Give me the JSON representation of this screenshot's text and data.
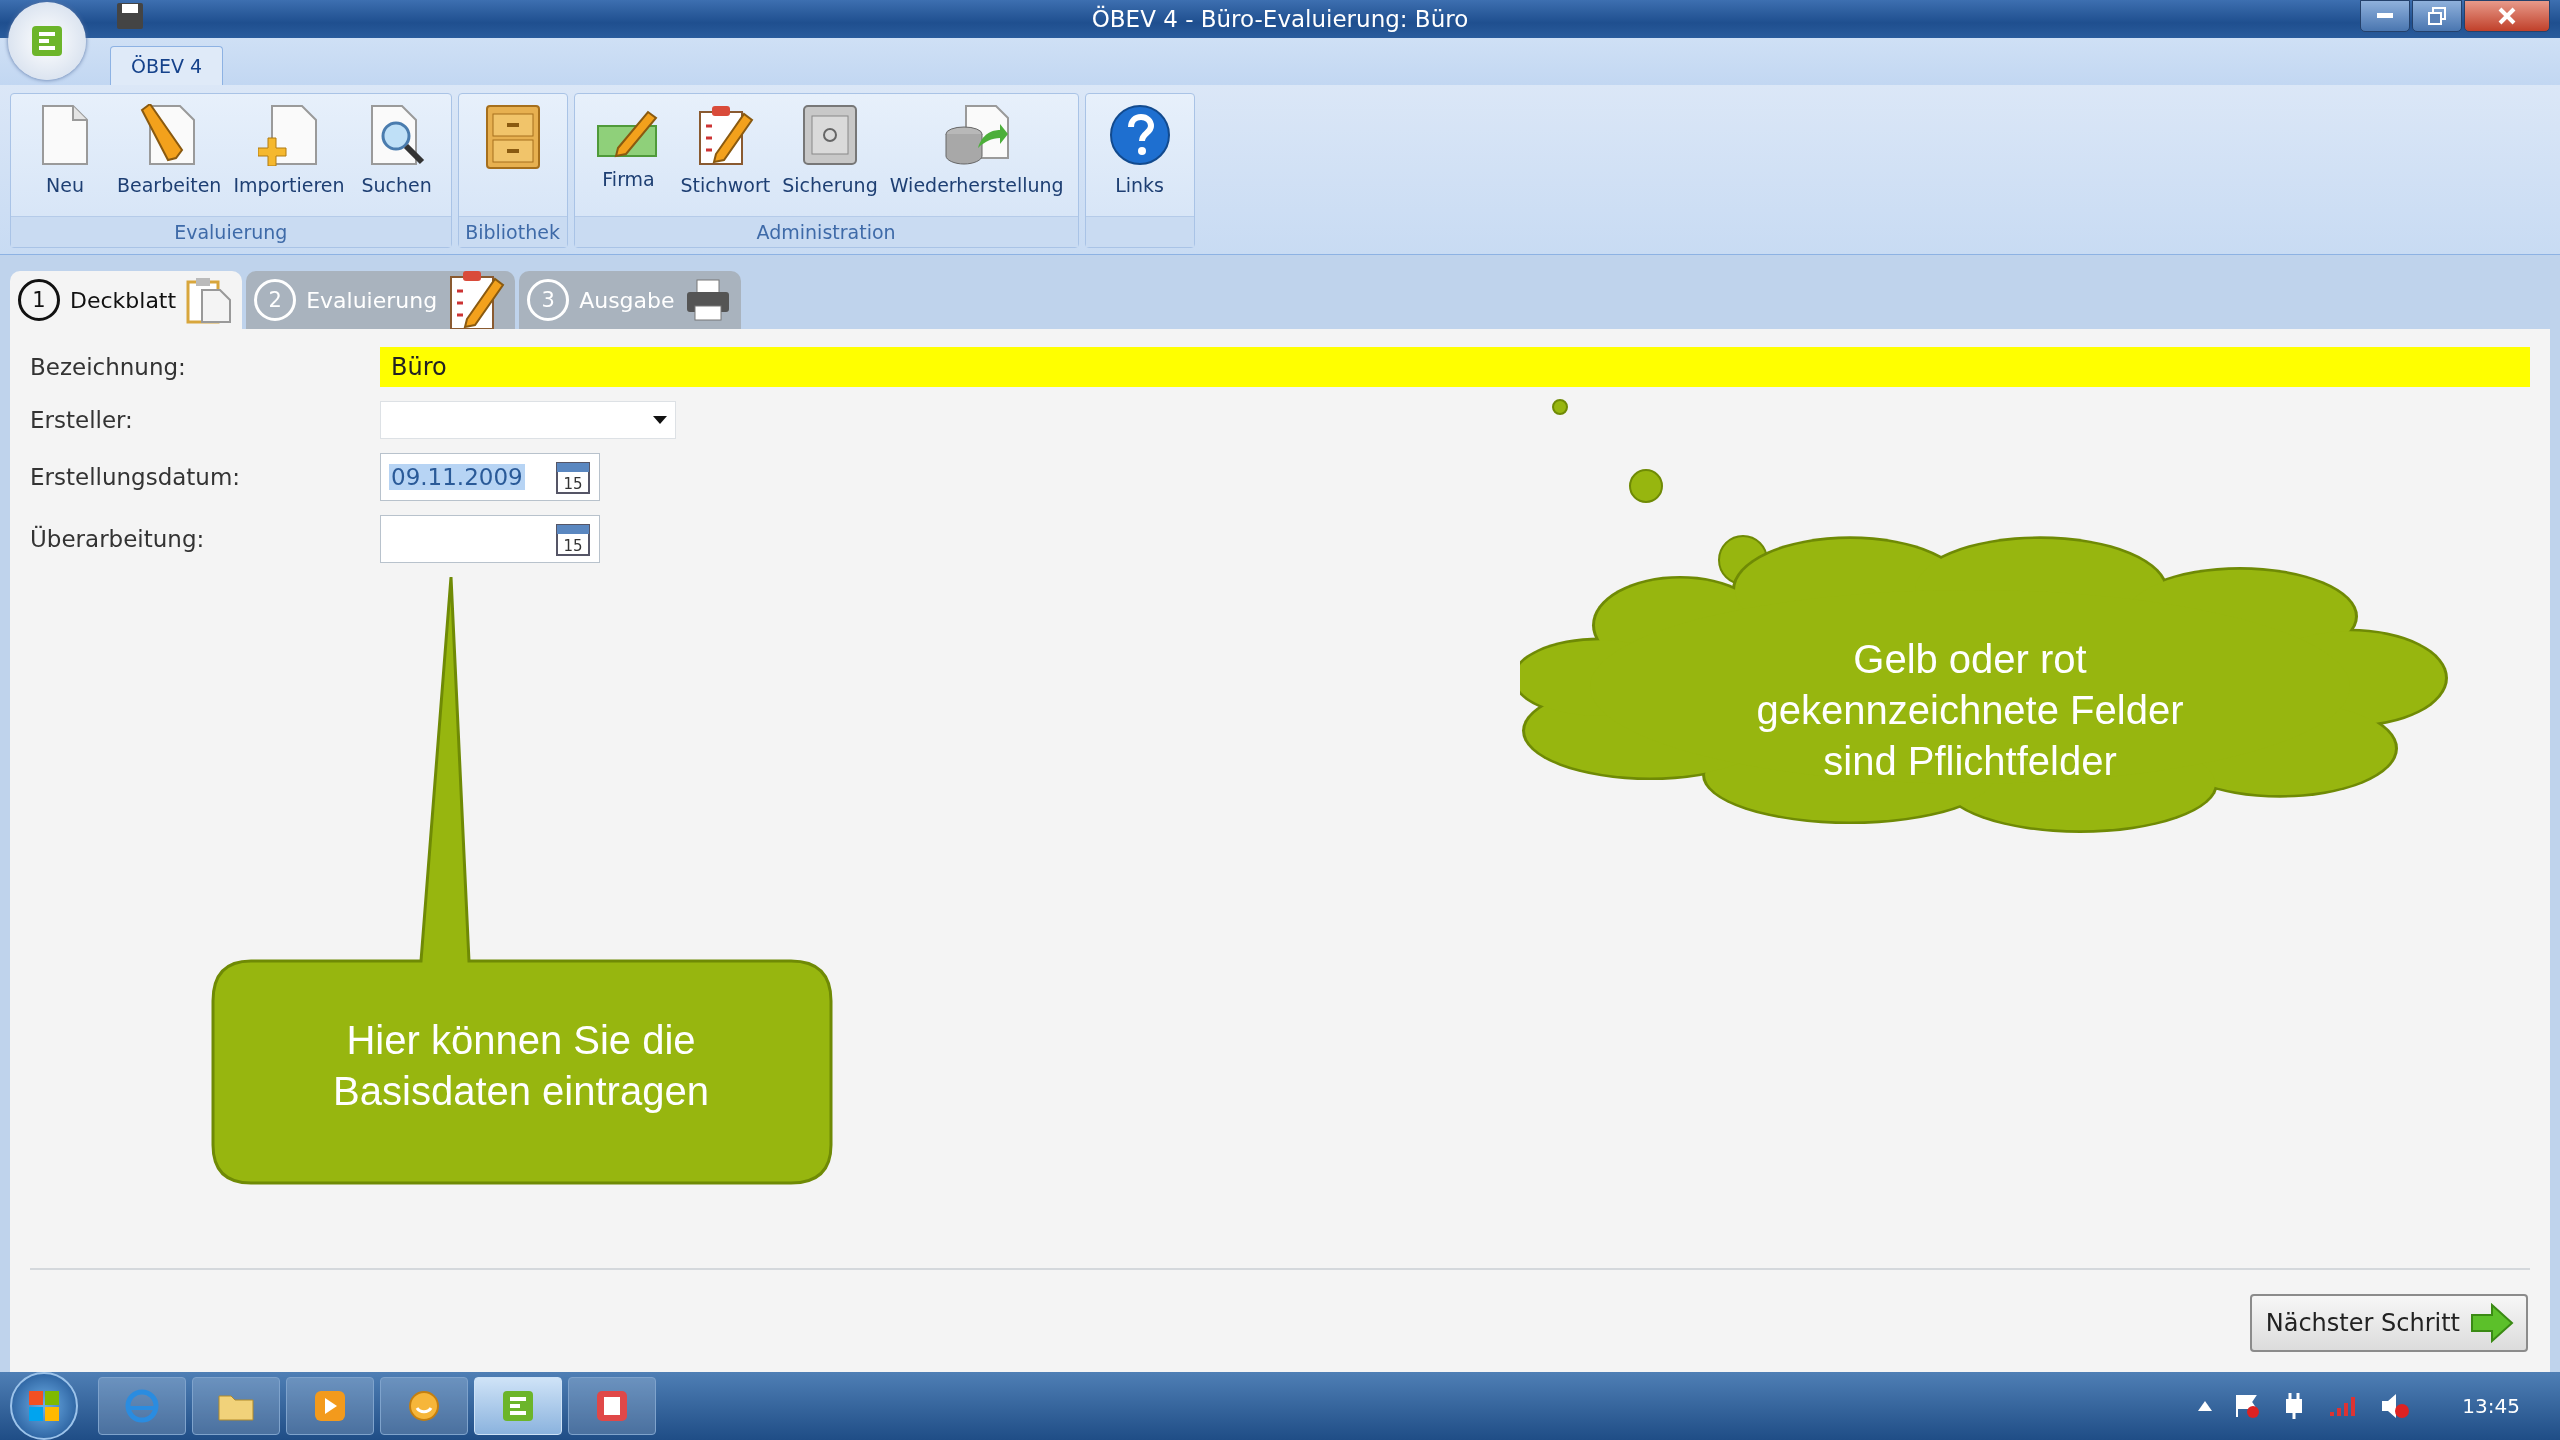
{
  "window": {
    "title": "ÖBEV 4 - Büro-Evaluierung: Büro"
  },
  "ribbon": {
    "tabs": [
      {
        "label": "ÖBEV 4",
        "selected": true
      }
    ],
    "groups": [
      {
        "label": "Evaluierung",
        "buttons": [
          {
            "label": "Neu",
            "kind": "page"
          },
          {
            "label": "Bearbeiten",
            "kind": "edit"
          },
          {
            "label": "Importieren",
            "kind": "import"
          },
          {
            "label": "Suchen",
            "kind": "search"
          }
        ]
      },
      {
        "label": "Bibliothek",
        "buttons": [
          {
            "kind": "cabinet"
          }
        ]
      },
      {
        "label": "Administration",
        "buttons": [
          {
            "label": "Firma",
            "kind": "card"
          },
          {
            "label": "Stichwort",
            "kind": "checklist"
          },
          {
            "label": "Sicherung",
            "kind": "safe"
          },
          {
            "label": "Wiederherstellung",
            "kind": "restore"
          }
        ]
      },
      {
        "buttons": [
          {
            "label": "Links",
            "kind": "help"
          }
        ]
      }
    ]
  },
  "steps": [
    {
      "number": "1",
      "label": "Deckblatt",
      "selected": true,
      "kind": "clipboard"
    },
    {
      "number": "2",
      "label": "Evaluierung",
      "selected": false,
      "kind": "checklist"
    },
    {
      "number": "3",
      "label": "Ausgabe",
      "selected": false,
      "kind": "printer"
    }
  ],
  "form": {
    "fields": [
      {
        "label": "Bezeichnung:",
        "kind": "text",
        "value": "Büro",
        "required": true
      },
      {
        "label": "Ersteller:",
        "kind": "dropdown",
        "required": false
      },
      {
        "label": "Erstellungsdatum:",
        "kind": "date",
        "value": "09.11.2009",
        "value_selected": true,
        "calendar_day": "15",
        "required": false
      },
      {
        "label": "Überarbeitung:",
        "kind": "date",
        "calendar_day": "15",
        "required": false
      }
    ]
  },
  "callouts": [
    {
      "kind": "speech",
      "text": "Hier können Sie die Basisdaten eintragen"
    },
    {
      "kind": "thought",
      "text": "Gelb oder rot gekennzeichnete Felder sind Pflichtfelder"
    }
  ],
  "next_button": {
    "label": "Nächster Schritt"
  },
  "taskbar": {
    "apps": [
      {
        "kind": "browser",
        "selected": false
      },
      {
        "kind": "folder",
        "selected": false
      },
      {
        "kind": "media",
        "selected": false
      },
      {
        "kind": "messenger",
        "selected": false
      },
      {
        "kind": "app",
        "selected": true
      },
      {
        "kind": "pdf",
        "selected": false
      }
    ],
    "clock": "13:45"
  }
}
